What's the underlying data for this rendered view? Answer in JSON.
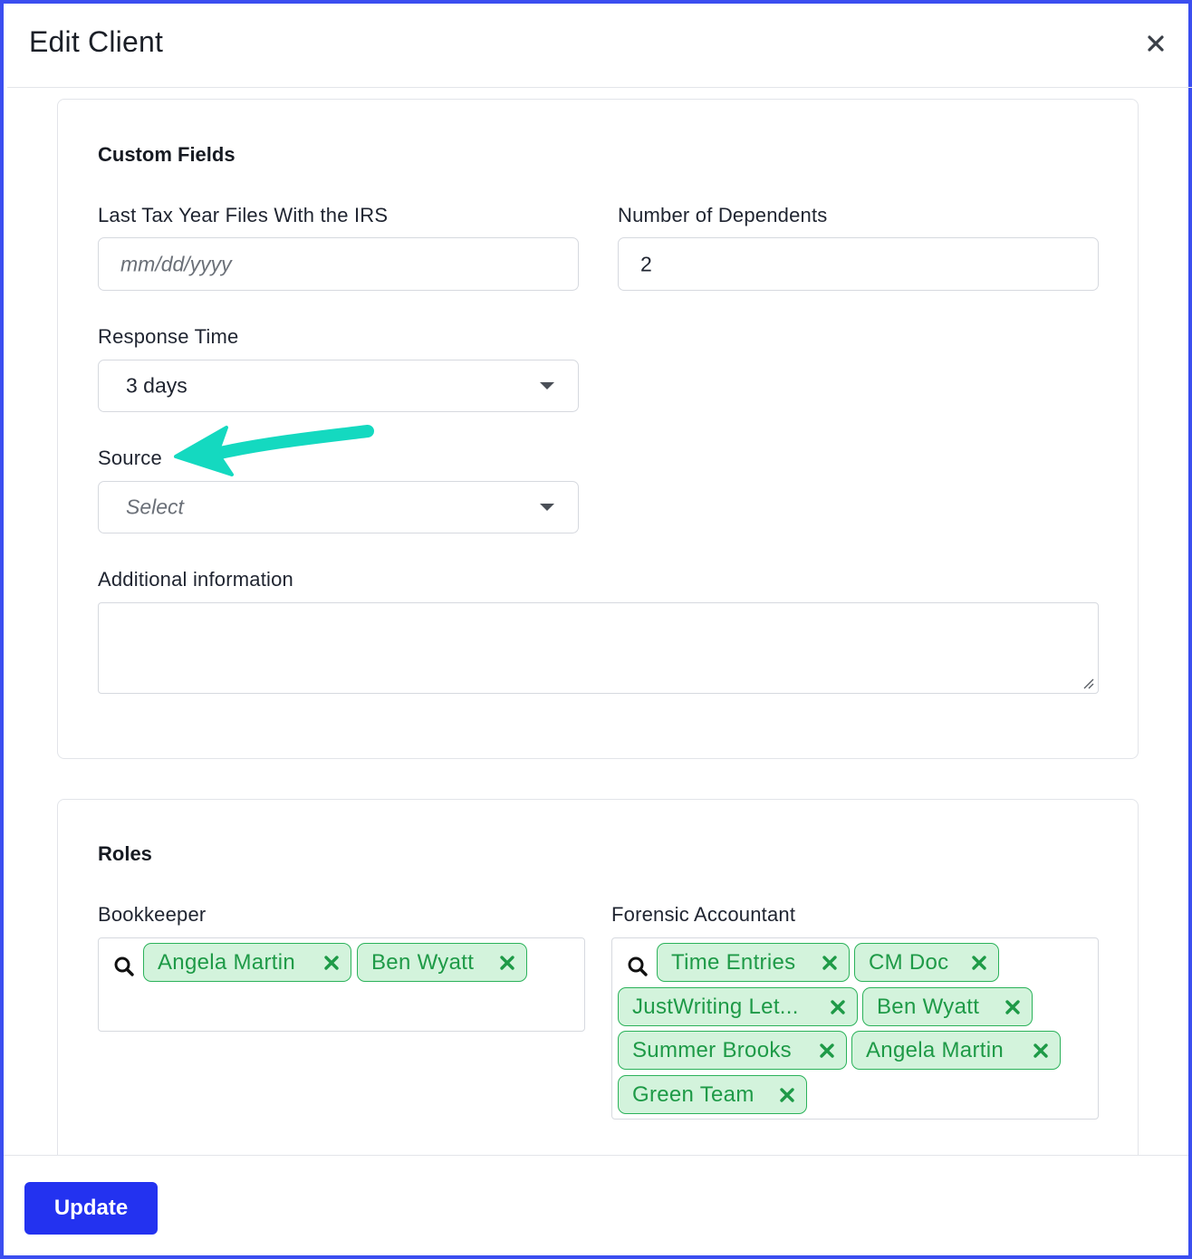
{
  "dialog": {
    "title": "Edit Client"
  },
  "custom_fields": {
    "section_title": "Custom Fields",
    "last_tax_year": {
      "label": "Last Tax Year Files With the IRS",
      "placeholder": "mm/dd/yyyy",
      "value": ""
    },
    "dependents": {
      "label": "Number of Dependents",
      "value": "2"
    },
    "response_time": {
      "label": "Response Time",
      "value": "3 days"
    },
    "source": {
      "label": "Source",
      "placeholder": "Select"
    },
    "additional_info": {
      "label": "Additional information",
      "value": ""
    }
  },
  "roles": {
    "section_title": "Roles",
    "bookkeeper": {
      "label": "Bookkeeper",
      "tags": [
        "Angela Martin",
        "Ben Wyatt"
      ]
    },
    "forensic_accountant": {
      "label": "Forensic Accountant",
      "tags": [
        "Time Entries",
        "CM Doc",
        "JustWriting Let...",
        "Ben Wyatt",
        "Summer Brooks",
        "Angela Martin",
        "Green Team"
      ]
    }
  },
  "footer": {
    "update_label": "Update"
  },
  "colors": {
    "primary": "#2332f0",
    "tag_bg": "#d3f3dc",
    "tag_text": "#1e9a47",
    "annotation_arrow": "#14d9c0",
    "frame": "#3b4ef0"
  },
  "icons": {
    "close": "close-icon",
    "search": "search-icon",
    "tag_remove": "remove-tag-icon",
    "dropdown": "chevron-down-icon"
  }
}
